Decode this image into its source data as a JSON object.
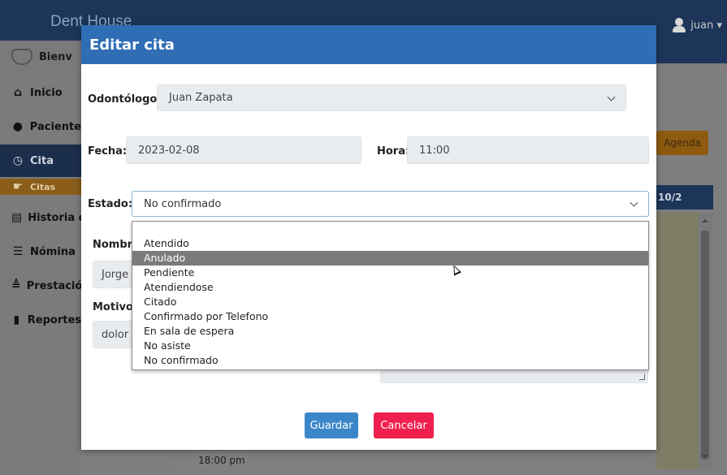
{
  "app": {
    "brand": "Dent House",
    "user": "juan ▾"
  },
  "sidebar": {
    "welcome": "Bienv",
    "items": [
      {
        "icon": "⌂",
        "label": "Inicio"
      },
      {
        "icon": "●",
        "label": "Paciente"
      },
      {
        "icon": "◷",
        "label": "Cita"
      },
      {
        "icon": "☛",
        "label": "Citas"
      },
      {
        "icon": "▤",
        "label": "Historia c"
      },
      {
        "icon": "☰",
        "label": "Nómina"
      },
      {
        "icon": "≜",
        "label": "Prestació"
      },
      {
        "icon": "▮",
        "label": "Reportes"
      }
    ]
  },
  "background": {
    "agenda_label": "Agenda",
    "grid_head": "10/2",
    "time_cell": "18:00 pm"
  },
  "modal": {
    "title": "Editar cita",
    "odontologo_label": "Odontólogo:",
    "odontologo_value": "Juan Zapata",
    "fecha_label": "Fecha:",
    "fecha_value": "2023-02-08",
    "hora_label": "Hora:",
    "hora_value": "11:00",
    "estado_label": "Estado:",
    "estado_value": "No confirmado",
    "nombre_label": "Nombre",
    "nombre_value": "Jorge",
    "motivo_label": "Motivo",
    "motivo_value": "dolor",
    "save_label": "Guardar",
    "cancel_label": "Cancelar"
  },
  "dropdown": {
    "highlighted": "Anulado",
    "options": [
      "Atendido",
      "Anulado",
      "Pendiente",
      "Atendiendose",
      "Citado",
      "Confirmado por Telefono",
      "En sala de espera",
      "No asiste",
      "No confirmado"
    ]
  },
  "colors": {
    "header": "#2f6db5",
    "save": "#3a86c8",
    "cancel": "#ef1f4e",
    "agenda": "#8d5a10"
  }
}
